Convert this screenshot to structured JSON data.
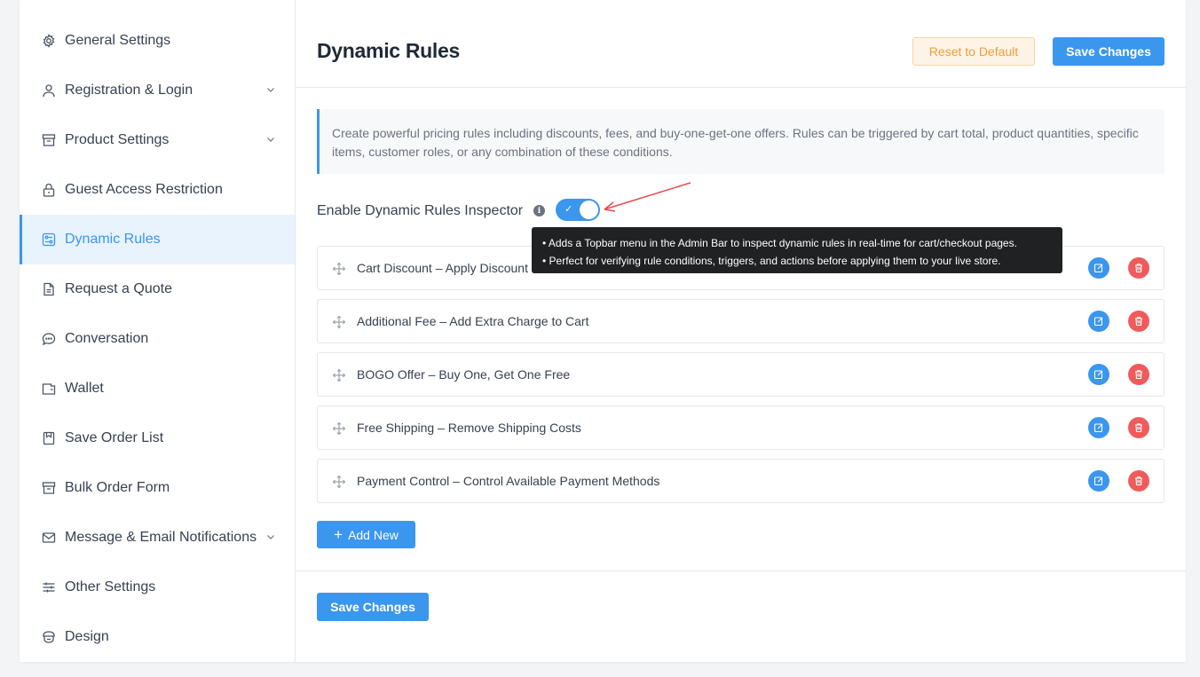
{
  "sidebar": {
    "items": [
      {
        "label": "General Settings",
        "icon": "gear-icon",
        "chevron": false,
        "active": false
      },
      {
        "label": "Registration & Login",
        "icon": "user-icon",
        "chevron": true,
        "active": false
      },
      {
        "label": "Product Settings",
        "icon": "box-icon",
        "chevron": true,
        "active": false
      },
      {
        "label": "Guest Access Restriction",
        "icon": "lock-icon",
        "chevron": false,
        "active": false
      },
      {
        "label": "Dynamic Rules",
        "icon": "rules-icon",
        "chevron": false,
        "active": true
      },
      {
        "label": "Request a Quote",
        "icon": "document-icon",
        "chevron": false,
        "active": false
      },
      {
        "label": "Conversation",
        "icon": "chat-icon",
        "chevron": false,
        "active": false
      },
      {
        "label": "Wallet",
        "icon": "wallet-icon",
        "chevron": false,
        "active": false
      },
      {
        "label": "Save Order List",
        "icon": "bookmark-icon",
        "chevron": false,
        "active": false
      },
      {
        "label": "Bulk Order Form",
        "icon": "archive-icon",
        "chevron": false,
        "active": false
      },
      {
        "label": "Message & Email Notifications",
        "icon": "mail-icon",
        "chevron": true,
        "active": false
      },
      {
        "label": "Other Settings",
        "icon": "sliders-icon",
        "chevron": false,
        "active": false
      },
      {
        "label": "Design",
        "icon": "design-icon",
        "chevron": false,
        "active": false
      }
    ]
  },
  "header": {
    "title": "Dynamic Rules",
    "reset_label": "Reset to Default",
    "save_label": "Save Changes"
  },
  "info": {
    "text": "Create powerful pricing rules including discounts, fees, and buy-one-get-one offers. Rules can be triggered by cart total, product quantities, specific items, customer roles, or any combination of these conditions."
  },
  "inspector": {
    "label": "Enable Dynamic Rules Inspector",
    "enabled": true,
    "tooltip": [
      "• Adds a Topbar menu in the Admin Bar to inspect dynamic rules in real-time for cart/checkout pages.",
      "• Perfect for verifying rule conditions, triggers, and actions before applying them to your live store."
    ]
  },
  "rules": [
    {
      "label": "Cart Discount – Apply Discount"
    },
    {
      "label": "Additional Fee – Add Extra Charge to Cart"
    },
    {
      "label": "BOGO Offer – Buy One, Get One Free"
    },
    {
      "label": "Free Shipping – Remove Shipping Costs"
    },
    {
      "label": "Payment Control – Control Available Payment Methods"
    }
  ],
  "add_new_label": "Add New",
  "footer": {
    "save_label": "Save Changes"
  },
  "colors": {
    "accent": "#3b96ee",
    "danger": "#ef5b5b",
    "warning": "#f19e35",
    "annotation": "#e5484d"
  }
}
